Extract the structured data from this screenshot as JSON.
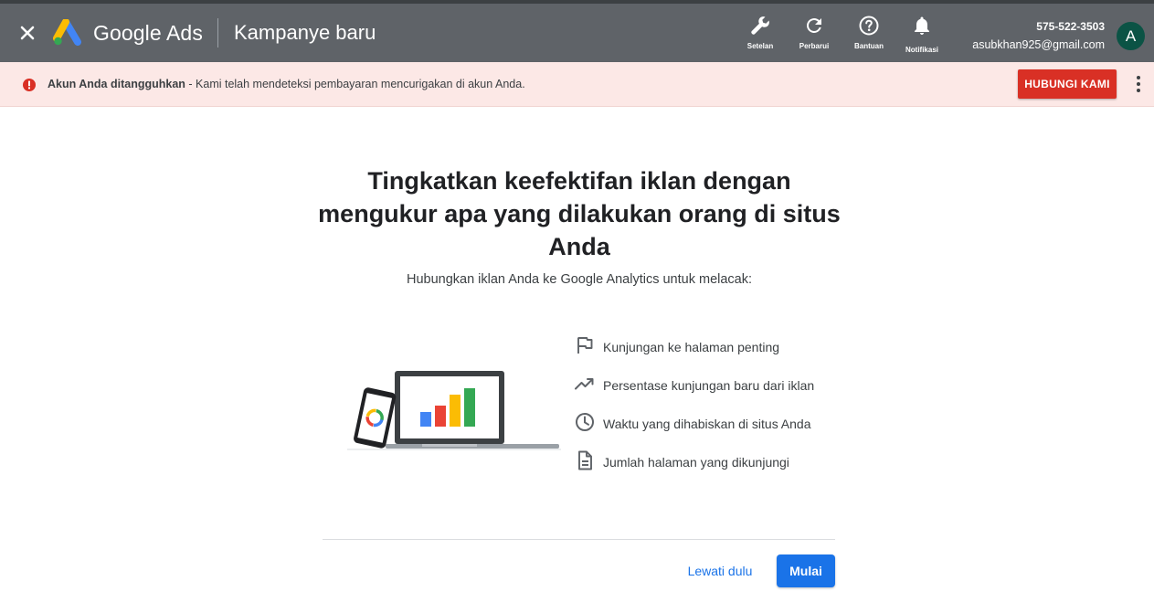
{
  "header": {
    "product_name": "Google Ads",
    "page_name": "Kampanye baru",
    "tools": [
      {
        "icon": "wrench-icon",
        "label": "Setelan"
      },
      {
        "icon": "refresh-icon",
        "label": "Perbarui"
      },
      {
        "icon": "help-icon",
        "label": "Bantuan"
      },
      {
        "icon": "bell-icon",
        "label": "Notifikasi"
      }
    ],
    "account": {
      "phone": "575-522-3503",
      "email": "asubkhan925@gmail.com",
      "avatar_initial": "A"
    }
  },
  "banner": {
    "title": "Akun Anda ditangguhkan",
    "message": " - Kami telah mendeteksi pembayaran mencurigakan di akun Anda.",
    "contact_label": "HUBUNGI KAMI"
  },
  "main": {
    "headline": "Tingkatkan keefektifan iklan dengan mengukur apa yang dilakukan orang di situs Anda",
    "subline": "Hubungkan iklan Anda ke Google Analytics untuk melacak:",
    "features": [
      {
        "icon": "flag-icon",
        "text": "Kunjungan ke halaman penting"
      },
      {
        "icon": "trending-up-icon",
        "text": "Persentase kunjungan baru dari iklan"
      },
      {
        "icon": "clock-icon",
        "text": "Waktu yang dihabiskan di situs Anda"
      },
      {
        "icon": "document-icon",
        "text": "Jumlah halaman yang dikunjungi"
      }
    ]
  },
  "footer": {
    "skip_label": "Lewati dulu",
    "start_label": "Mulai"
  },
  "colors": {
    "header_bg": "#5f6368",
    "banner_bg": "#fce8e6",
    "error_red": "#d93025",
    "primary_blue": "#1a73e8"
  }
}
